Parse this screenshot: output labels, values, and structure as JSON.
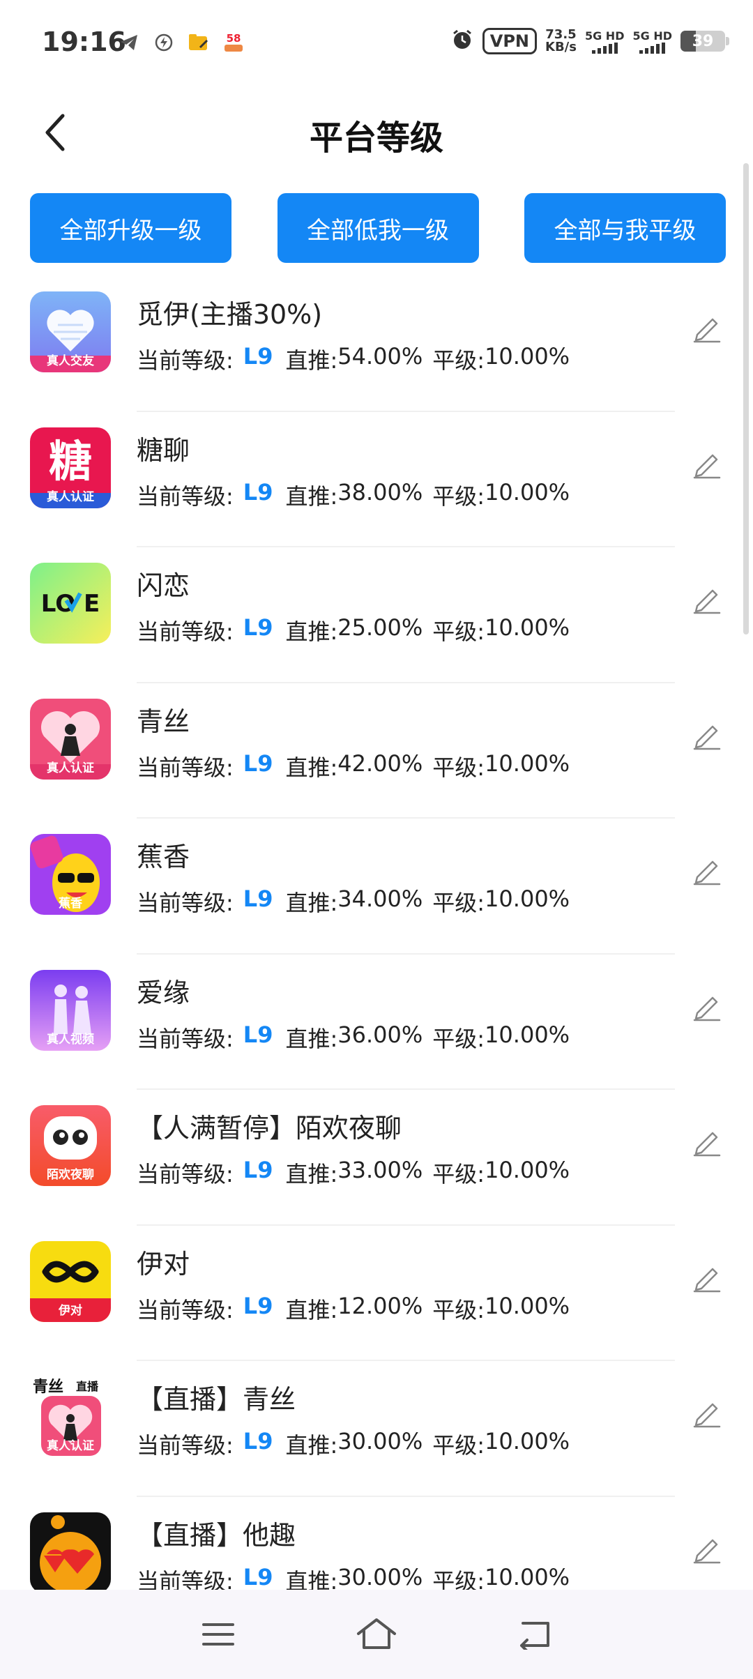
{
  "status_bar": {
    "time": "19:16",
    "vpn": "VPN",
    "net_speed_value": "73.5",
    "net_speed_unit": "KB/s",
    "sim1": "5G HD",
    "sim2": "5G HD",
    "battery": "39",
    "notification_badge": "58"
  },
  "header": {
    "title": "平台等级",
    "back_icon": "chevron-left-icon"
  },
  "actions": {
    "upgrade_all": "全部升级一级",
    "lower_all": "全部低我一级",
    "equal_all": "全部与我平级"
  },
  "labels": {
    "current_level": "当前等级:",
    "direct": "直推:",
    "peer": "平级:"
  },
  "platforms": [
    {
      "name": "觅伊(主播30%)",
      "level": "L9",
      "direct": "54.00%",
      "peer": "10.00%",
      "icon": "heart-icon",
      "icon_bg": "#6ea0f5",
      "badge": "真人交友"
    },
    {
      "name": "糖聊",
      "level": "L9",
      "direct": "38.00%",
      "peer": "10.00%",
      "icon": "tang-icon",
      "icon_bg": "#e8174f",
      "badge": "真人认证"
    },
    {
      "name": "闪恋",
      "level": "L9",
      "direct": "25.00%",
      "peer": "10.00%",
      "icon": "love-icon",
      "icon_bg": "#b7ee5e",
      "badge": ""
    },
    {
      "name": "青丝",
      "level": "L9",
      "direct": "42.00%",
      "peer": "10.00%",
      "icon": "girl-heart-icon",
      "icon_bg": "#f04e7a",
      "badge": "真人认证"
    },
    {
      "name": "蕉香",
      "level": "L9",
      "direct": "34.00%",
      "peer": "10.00%",
      "icon": "banana-icon",
      "icon_bg": "#a040f0",
      "badge": "蕉香"
    },
    {
      "name": "爱缘",
      "level": "L9",
      "direct": "36.00%",
      "peer": "10.00%",
      "icon": "couple-icon",
      "icon_bg": "#a05ae8",
      "badge": "真人视频"
    },
    {
      "name": "【人满暂停】陌欢夜聊",
      "level": "L9",
      "direct": "33.00%",
      "peer": "10.00%",
      "icon": "chat-face-icon",
      "icon_bg": "#f45a50",
      "badge": "陌欢夜聊"
    },
    {
      "name": "伊对",
      "level": "L9",
      "direct": "12.00%",
      "peer": "10.00%",
      "icon": "infinity-icon",
      "icon_bg": "#f7dc10",
      "badge": "伊对"
    },
    {
      "name": "【直播】青丝",
      "level": "L9",
      "direct": "30.00%",
      "peer": "10.00%",
      "icon": "live-girl-icon",
      "icon_bg": "#f04e7a",
      "badge": "真人认证",
      "top_label": "青丝 直播"
    },
    {
      "name": "【直播】他趣",
      "level": "L9",
      "direct": "30.00%",
      "peer": "10.00%",
      "icon": "smiley-icon",
      "icon_bg": "#f5a010",
      "badge": ""
    }
  ],
  "colors": {
    "accent": "#1487f5",
    "button_text": "#ffffff"
  }
}
